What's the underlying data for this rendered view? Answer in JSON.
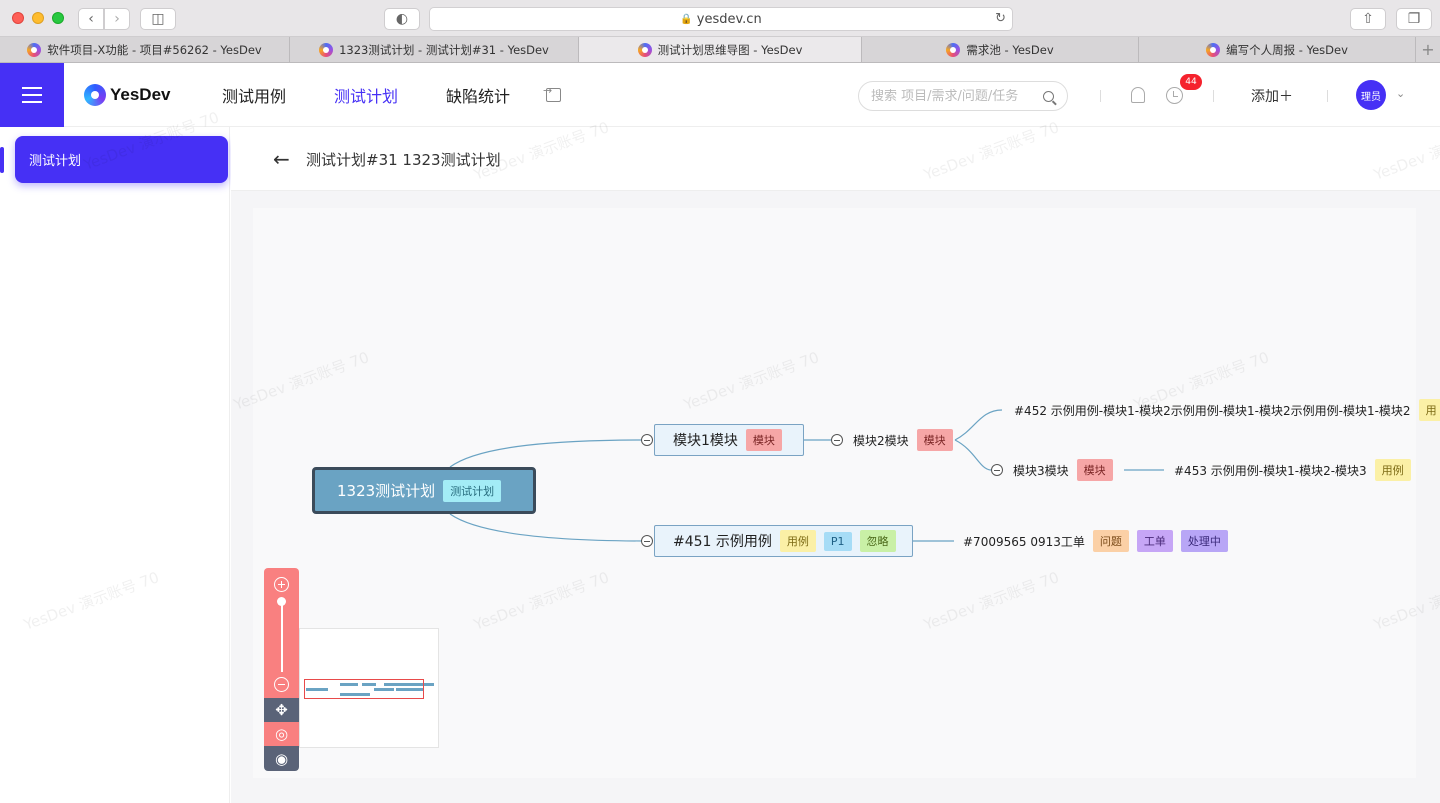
{
  "browser": {
    "url": "yesdev.cn",
    "tabs": [
      {
        "label": "软件项目-X功能 - 项目#56262 - YesDev"
      },
      {
        "label": "1323测试计划 - 测试计划#31 - YesDev"
      },
      {
        "label": "测试计划思维导图 - YesDev"
      },
      {
        "label": "需求池 - YesDev"
      },
      {
        "label": "编写个人周报 - YesDev"
      }
    ],
    "new_tab": "+"
  },
  "header": {
    "logo": "YesDev",
    "nav": [
      "测试用例",
      "测试计划",
      "缺陷统计"
    ],
    "active_nav": "测试计划",
    "search_placeholder": "搜索 项目/需求/问题/任务",
    "notification_count": "44",
    "add_label": "添加＋",
    "avatar_text": "理员",
    "colors": {
      "brand": "#4630f5"
    }
  },
  "sidebar": {
    "items": [
      {
        "label": "测试计划"
      }
    ]
  },
  "page": {
    "back_arrow": "←",
    "title": "测试计划#31 1323测试计划"
  },
  "watermark": "YesDev 演示账号 70",
  "mindmap": {
    "root": {
      "label": "1323测试计划",
      "tag": "测试计划"
    },
    "module1": {
      "label": "模块1模块",
      "tag": "模块"
    },
    "module2": {
      "label": "模块2模块",
      "tag": "模块"
    },
    "module3": {
      "label": "模块3模块",
      "tag": "模块"
    },
    "case452": {
      "label": "#452 示例用例-模块1-模块2示例用例-模块1-模块2示例用例-模块1-模块2",
      "tag": "用"
    },
    "case453": {
      "label": "#453 示例用例-模块1-模块2-模块3",
      "tag": "用例"
    },
    "case451": {
      "label": "#451 示例用例",
      "tags": [
        "用例",
        "P1",
        "忽略"
      ]
    },
    "issue": {
      "label": "#7009565 0913工单",
      "tags": [
        "问题",
        "工单",
        "处理中"
      ]
    }
  },
  "tools": {
    "zoom_in": "plus-icon",
    "zoom_out": "minus-icon",
    "move": "move-icon",
    "center": "target-icon",
    "preview": "eye-icon"
  }
}
